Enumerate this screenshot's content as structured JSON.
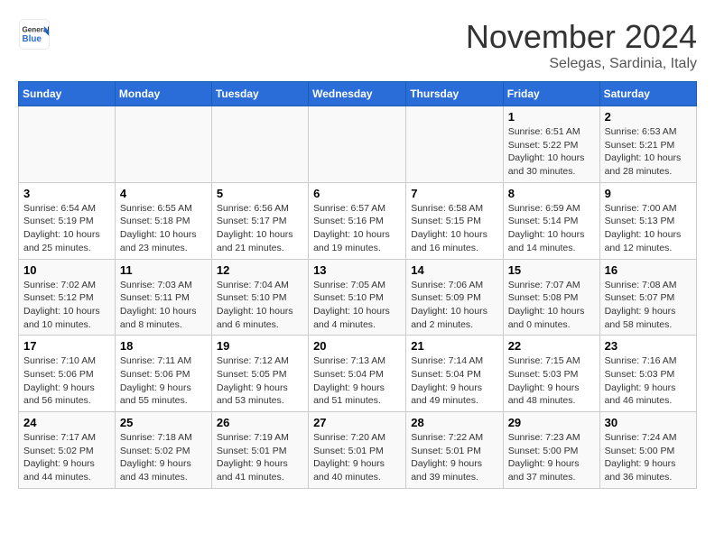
{
  "header": {
    "logo_line1": "General",
    "logo_line2": "Blue",
    "month": "November 2024",
    "location": "Selegas, Sardinia, Italy"
  },
  "weekdays": [
    "Sunday",
    "Monday",
    "Tuesday",
    "Wednesday",
    "Thursday",
    "Friday",
    "Saturday"
  ],
  "weeks": [
    [
      {
        "day": "",
        "info": ""
      },
      {
        "day": "",
        "info": ""
      },
      {
        "day": "",
        "info": ""
      },
      {
        "day": "",
        "info": ""
      },
      {
        "day": "",
        "info": ""
      },
      {
        "day": "1",
        "info": "Sunrise: 6:51 AM\nSunset: 5:22 PM\nDaylight: 10 hours and 30 minutes."
      },
      {
        "day": "2",
        "info": "Sunrise: 6:53 AM\nSunset: 5:21 PM\nDaylight: 10 hours and 28 minutes."
      }
    ],
    [
      {
        "day": "3",
        "info": "Sunrise: 6:54 AM\nSunset: 5:19 PM\nDaylight: 10 hours and 25 minutes."
      },
      {
        "day": "4",
        "info": "Sunrise: 6:55 AM\nSunset: 5:18 PM\nDaylight: 10 hours and 23 minutes."
      },
      {
        "day": "5",
        "info": "Sunrise: 6:56 AM\nSunset: 5:17 PM\nDaylight: 10 hours and 21 minutes."
      },
      {
        "day": "6",
        "info": "Sunrise: 6:57 AM\nSunset: 5:16 PM\nDaylight: 10 hours and 19 minutes."
      },
      {
        "day": "7",
        "info": "Sunrise: 6:58 AM\nSunset: 5:15 PM\nDaylight: 10 hours and 16 minutes."
      },
      {
        "day": "8",
        "info": "Sunrise: 6:59 AM\nSunset: 5:14 PM\nDaylight: 10 hours and 14 minutes."
      },
      {
        "day": "9",
        "info": "Sunrise: 7:00 AM\nSunset: 5:13 PM\nDaylight: 10 hours and 12 minutes."
      }
    ],
    [
      {
        "day": "10",
        "info": "Sunrise: 7:02 AM\nSunset: 5:12 PM\nDaylight: 10 hours and 10 minutes."
      },
      {
        "day": "11",
        "info": "Sunrise: 7:03 AM\nSunset: 5:11 PM\nDaylight: 10 hours and 8 minutes."
      },
      {
        "day": "12",
        "info": "Sunrise: 7:04 AM\nSunset: 5:10 PM\nDaylight: 10 hours and 6 minutes."
      },
      {
        "day": "13",
        "info": "Sunrise: 7:05 AM\nSunset: 5:10 PM\nDaylight: 10 hours and 4 minutes."
      },
      {
        "day": "14",
        "info": "Sunrise: 7:06 AM\nSunset: 5:09 PM\nDaylight: 10 hours and 2 minutes."
      },
      {
        "day": "15",
        "info": "Sunrise: 7:07 AM\nSunset: 5:08 PM\nDaylight: 10 hours and 0 minutes."
      },
      {
        "day": "16",
        "info": "Sunrise: 7:08 AM\nSunset: 5:07 PM\nDaylight: 9 hours and 58 minutes."
      }
    ],
    [
      {
        "day": "17",
        "info": "Sunrise: 7:10 AM\nSunset: 5:06 PM\nDaylight: 9 hours and 56 minutes."
      },
      {
        "day": "18",
        "info": "Sunrise: 7:11 AM\nSunset: 5:06 PM\nDaylight: 9 hours and 55 minutes."
      },
      {
        "day": "19",
        "info": "Sunrise: 7:12 AM\nSunset: 5:05 PM\nDaylight: 9 hours and 53 minutes."
      },
      {
        "day": "20",
        "info": "Sunrise: 7:13 AM\nSunset: 5:04 PM\nDaylight: 9 hours and 51 minutes."
      },
      {
        "day": "21",
        "info": "Sunrise: 7:14 AM\nSunset: 5:04 PM\nDaylight: 9 hours and 49 minutes."
      },
      {
        "day": "22",
        "info": "Sunrise: 7:15 AM\nSunset: 5:03 PM\nDaylight: 9 hours and 48 minutes."
      },
      {
        "day": "23",
        "info": "Sunrise: 7:16 AM\nSunset: 5:03 PM\nDaylight: 9 hours and 46 minutes."
      }
    ],
    [
      {
        "day": "24",
        "info": "Sunrise: 7:17 AM\nSunset: 5:02 PM\nDaylight: 9 hours and 44 minutes."
      },
      {
        "day": "25",
        "info": "Sunrise: 7:18 AM\nSunset: 5:02 PM\nDaylight: 9 hours and 43 minutes."
      },
      {
        "day": "26",
        "info": "Sunrise: 7:19 AM\nSunset: 5:01 PM\nDaylight: 9 hours and 41 minutes."
      },
      {
        "day": "27",
        "info": "Sunrise: 7:20 AM\nSunset: 5:01 PM\nDaylight: 9 hours and 40 minutes."
      },
      {
        "day": "28",
        "info": "Sunrise: 7:22 AM\nSunset: 5:01 PM\nDaylight: 9 hours and 39 minutes."
      },
      {
        "day": "29",
        "info": "Sunrise: 7:23 AM\nSunset: 5:00 PM\nDaylight: 9 hours and 37 minutes."
      },
      {
        "day": "30",
        "info": "Sunrise: 7:24 AM\nSunset: 5:00 PM\nDaylight: 9 hours and 36 minutes."
      }
    ]
  ]
}
